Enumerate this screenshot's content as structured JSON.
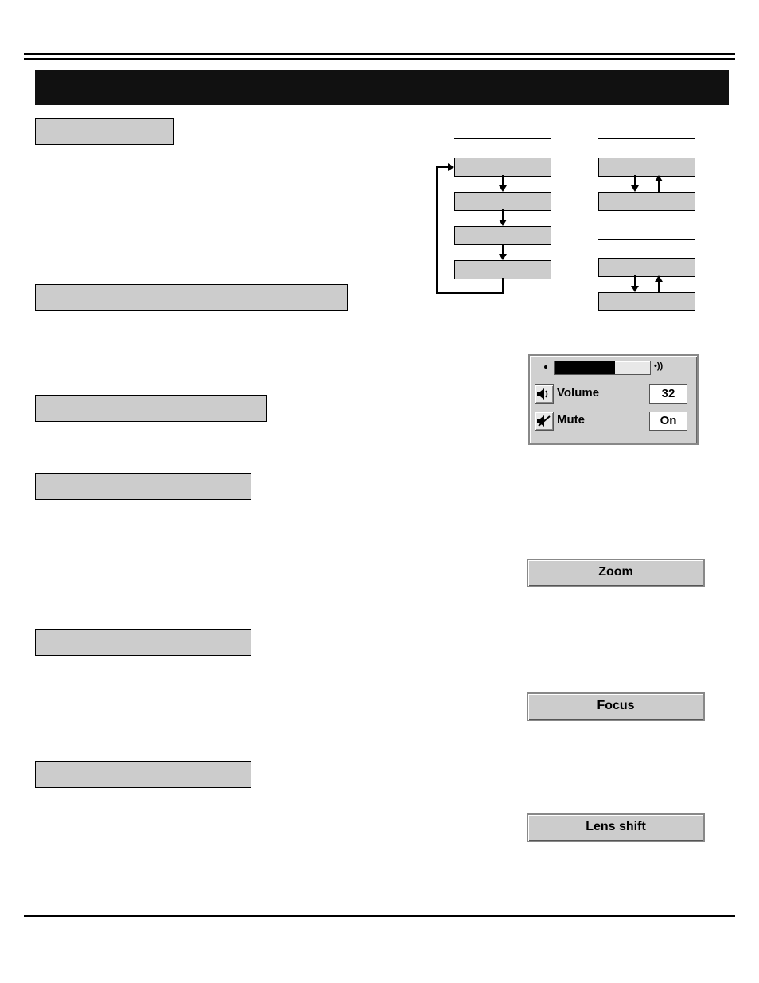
{
  "volume_panel": {
    "volume_label": "Volume",
    "volume_value": "32",
    "mute_label": "Mute",
    "mute_value": "On"
  },
  "buttons": {
    "zoom": "Zoom",
    "focus": "Focus",
    "lens_shift": "Lens shift"
  }
}
